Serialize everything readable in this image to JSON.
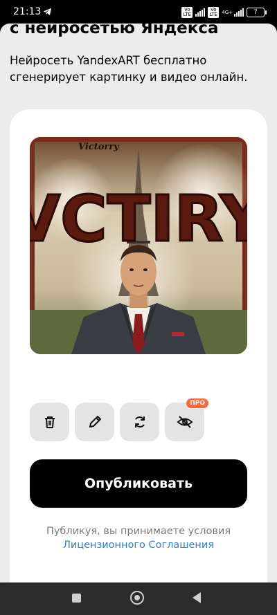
{
  "status_bar": {
    "time": "21:13",
    "network": "4G+",
    "battery": "7"
  },
  "page": {
    "headline": "с нейросетью Яндекса",
    "subtitle": "Нейросеть YandexART бесплатно сгенерирует картинку и видео онлайн."
  },
  "image": {
    "caption_small": "Victorry",
    "caption_big": "VCTIRY"
  },
  "actions": {
    "delete_icon": "trash-icon",
    "edit_icon": "pencil-icon",
    "regenerate_icon": "refresh-icon",
    "hide_icon": "eye-off-icon",
    "pro_badge": "ПРО"
  },
  "publish_button": "Опубликовать",
  "terms": {
    "text": "Публикуя, вы принимаете условия",
    "link": "Лицензионного Соглашения"
  },
  "colors": {
    "accent_link": "#2f7fd3",
    "pro_badge": "#ff6a3d",
    "button_bg": "#000000"
  }
}
